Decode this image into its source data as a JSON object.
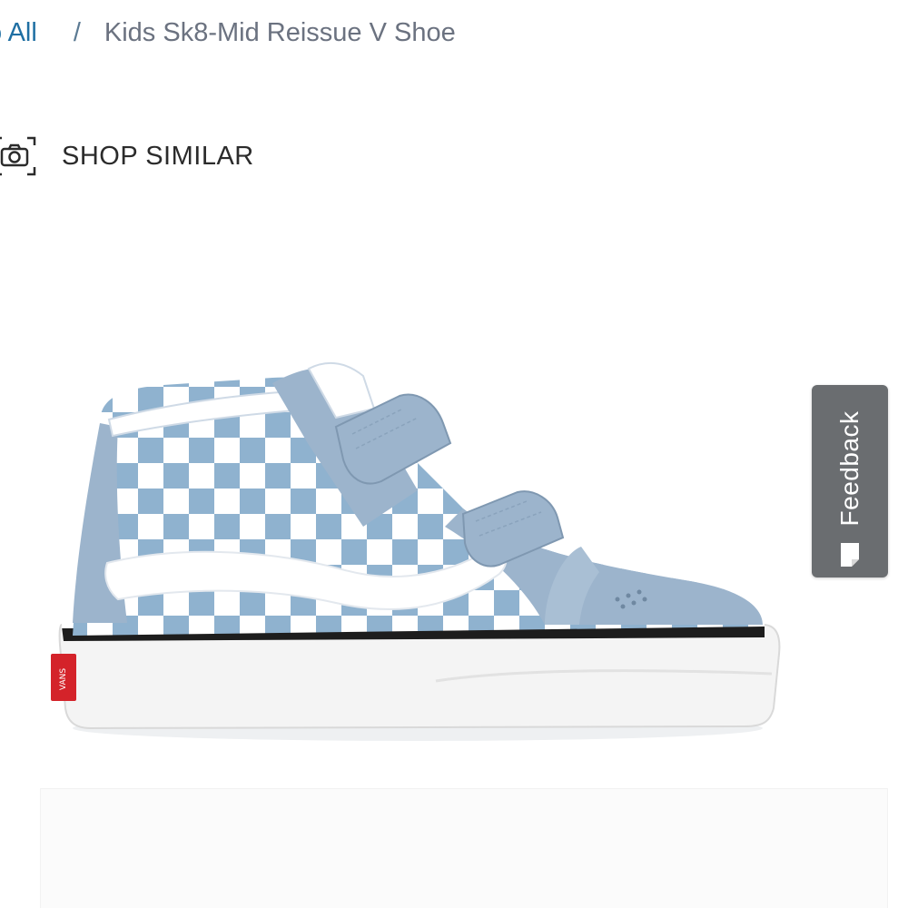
{
  "breadcrumb": {
    "back_link": "o All",
    "separator": "/",
    "current": "Kids Sk8-Mid Reissue V Shoe"
  },
  "shop_similar": {
    "label": "SHOP SIMILAR",
    "icon": "camera-scan-icon"
  },
  "product_image": {
    "subject": "shoe",
    "icon": "vans-logo-icon"
  },
  "feedback": {
    "label": "Feedback",
    "icon": "feedback-icon"
  },
  "colors": {
    "link": "#1f6fa3",
    "text": "#2b2b2b",
    "feedback_bg": "#6a6d70",
    "shoe_blue": "#9cb4cc",
    "check_blue": "#8fb2cf",
    "brand_red": "#d4232a"
  }
}
